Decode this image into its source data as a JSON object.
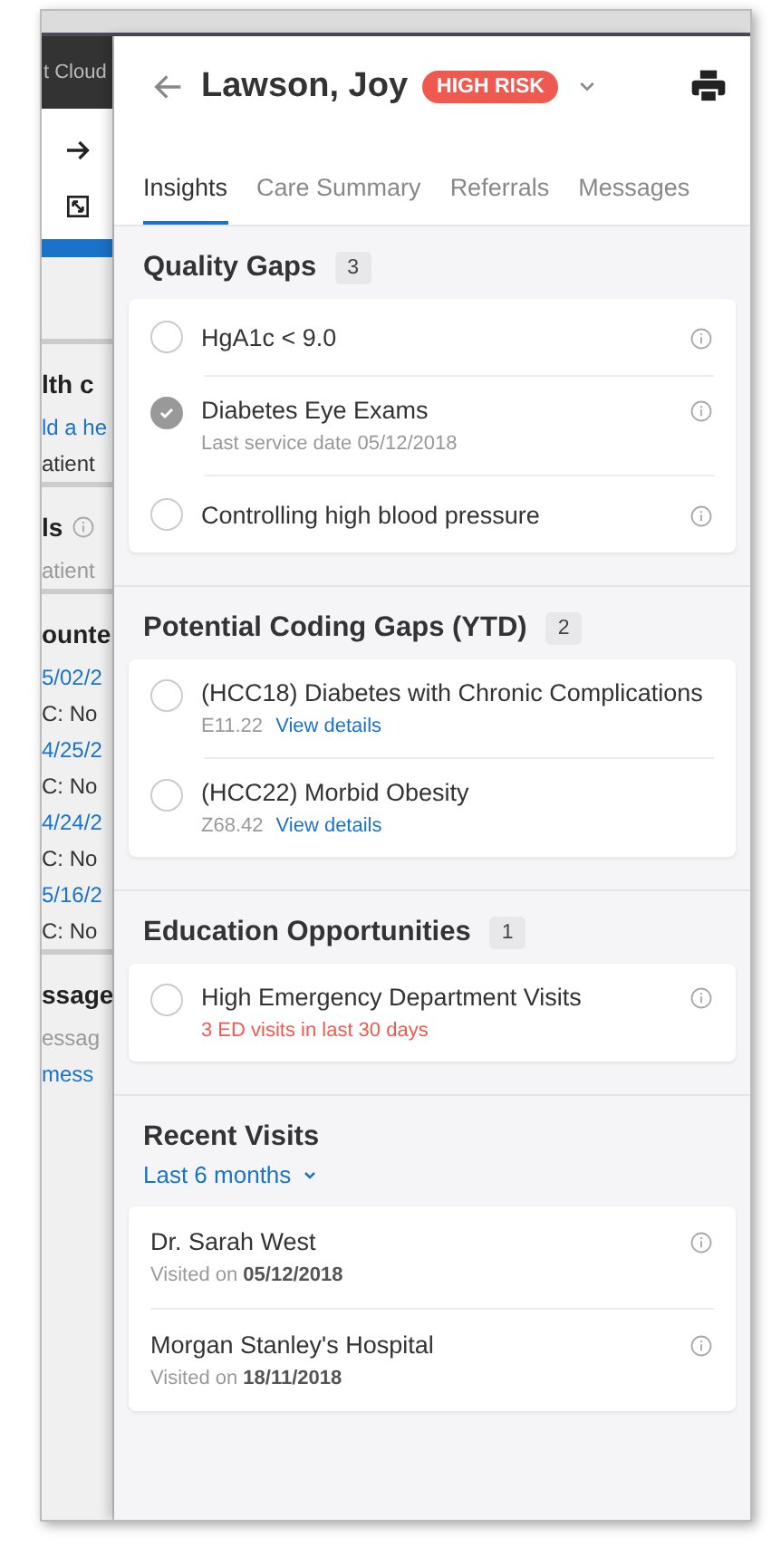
{
  "background_app": {
    "brand": "t Cloud",
    "groups": [
      {
        "items": [
          {
            "kind": "heading",
            "text": "lth c",
            "info": false
          },
          {
            "kind": "link",
            "text": "ld a he"
          },
          {
            "kind": "text",
            "text": "atient"
          }
        ]
      },
      {
        "items": [
          {
            "kind": "heading",
            "text": "ls",
            "info": true
          },
          {
            "kind": "muted",
            "text": "atient"
          }
        ]
      },
      {
        "items": [
          {
            "kind": "heading",
            "text": "ounte",
            "info": false
          },
          {
            "kind": "link",
            "text": "5/02/2"
          },
          {
            "kind": "text",
            "text": "C: No"
          },
          {
            "kind": "link",
            "text": "4/25/2"
          },
          {
            "kind": "text",
            "text": "C: No"
          },
          {
            "kind": "link",
            "text": "4/24/2"
          },
          {
            "kind": "text",
            "text": "C: No"
          },
          {
            "kind": "link",
            "text": "5/16/2"
          },
          {
            "kind": "text",
            "text": "C: No"
          }
        ]
      },
      {
        "items": [
          {
            "kind": "heading",
            "text": "ssage",
            "info": false
          },
          {
            "kind": "muted",
            "text": "essag"
          },
          {
            "kind": "link",
            "text": "mess"
          }
        ]
      }
    ]
  },
  "patient": {
    "name": "Lawson, Joy",
    "risk": "HIGH RISK"
  },
  "tabs": [
    {
      "label": "Insights",
      "selected": true
    },
    {
      "label": "Care Summary",
      "selected": false
    },
    {
      "label": "Referrals",
      "selected": false
    },
    {
      "label": "Messages",
      "selected": false
    }
  ],
  "sections": [
    {
      "title": "Quality Gaps",
      "count": "3",
      "items": [
        {
          "kind": "plain",
          "title": "HgA1c  < 9.0",
          "checked": false,
          "info": true
        },
        {
          "kind": "note",
          "title": "Diabetes Eye Exams",
          "checked": true,
          "info": true,
          "detail": "Last service date 05/12/2018"
        },
        {
          "kind": "plain",
          "title": "Controlling high blood pressure",
          "checked": false,
          "info": true
        }
      ]
    },
    {
      "title": "Potential Coding Gaps (YTD)",
      "count": "2",
      "items": [
        {
          "kind": "note",
          "title": "(HCC18) Diabetes with Chronic Complications",
          "checked": false,
          "info": false,
          "detail": "E11.22",
          "link": "View details"
        },
        {
          "kind": "note",
          "title": "(HCC22) Morbid Obesity",
          "checked": false,
          "info": false,
          "detail": "Z68.42",
          "link": "View details"
        }
      ]
    },
    {
      "title": "Education Opportunities",
      "count": "1",
      "items": [
        {
          "kind": "alert",
          "title": "High Emergency Department Visits",
          "checked": false,
          "info": true,
          "detail": "3 ED visits in last 30 days"
        }
      ]
    }
  ],
  "recent_visits": {
    "title": "Recent Visits",
    "filter": "Last 6 months",
    "visits": [
      {
        "name": "Dr. Sarah West",
        "detail": "Visited on **05/12/2018**",
        "info": true
      },
      {
        "name": "Morgan Stanley's Hospital",
        "detail": "Visited on **18/11/2018**",
        "info": true
      }
    ]
  }
}
